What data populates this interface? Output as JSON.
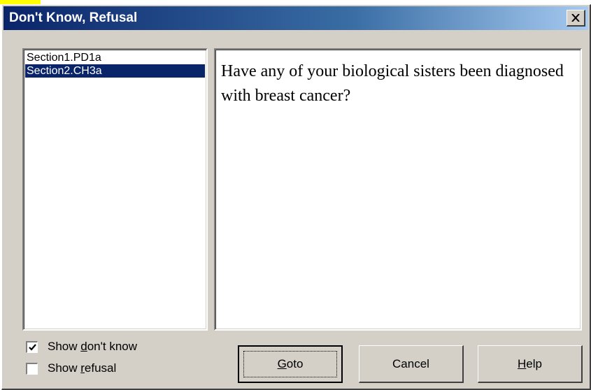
{
  "window": {
    "title": "Don't Know, Refusal",
    "close_icon": "close-icon"
  },
  "list": {
    "items": [
      {
        "label": "Section1.PD1a",
        "selected": false
      },
      {
        "label": "Section2.CH3a",
        "selected": true
      }
    ]
  },
  "question": {
    "text": "Have any of your biological sisters been diagnosed with breast cancer?"
  },
  "options": {
    "show_dont_know": {
      "label_pre": "Show ",
      "label_accel": "d",
      "label_post": "on't know",
      "checked": true
    },
    "show_refusal": {
      "label_pre": "Show ",
      "label_accel": "r",
      "label_post": "efusal",
      "checked": false
    }
  },
  "buttons": {
    "goto": {
      "label_accel": "G",
      "label_post": "oto"
    },
    "cancel": {
      "label": "Cancel"
    },
    "help": {
      "label_accel": "H",
      "label_post": "elp"
    }
  },
  "colors": {
    "title_start": "#0a246a",
    "title_end": "#a6caf0",
    "face": "#d4d0c8",
    "selection": "#0a246a",
    "yellow_highlight": "#ffff00"
  }
}
